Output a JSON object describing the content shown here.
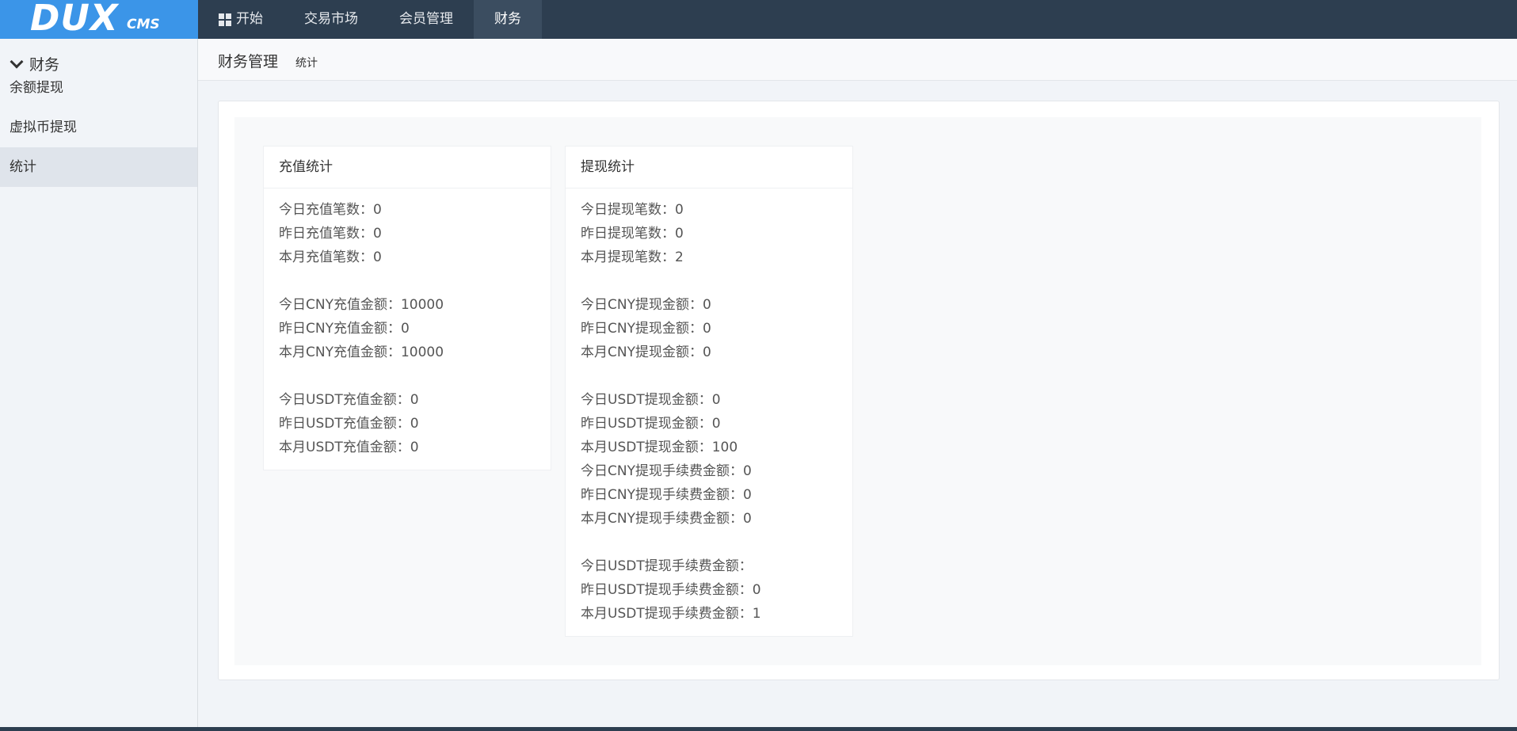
{
  "logo": {
    "main": "DUX",
    "sub": "CMS"
  },
  "nav": {
    "items": [
      {
        "label": "开始",
        "icon": "windows-icon"
      },
      {
        "label": "交易市场"
      },
      {
        "label": "会员管理"
      },
      {
        "label": "财务",
        "active": true
      }
    ]
  },
  "sidebar": {
    "heading": "财务",
    "items": [
      {
        "label": "余额提现"
      },
      {
        "label": "虚拟币提现"
      },
      {
        "label": "统计",
        "active": true
      }
    ]
  },
  "page": {
    "title": "财务管理",
    "breadcrumb": "统计"
  },
  "recharge": {
    "title": "充值统计",
    "lines": [
      "今日充值笔数：0",
      "昨日充值笔数：0",
      "本月充值笔数：0",
      "今日CNY充值金额：10000",
      "昨日CNY充值金额：0",
      "本月CNY充值金额：10000",
      "今日USDT充值金额：0",
      "昨日USDT充值金额：0",
      "本月USDT充值金额：0"
    ]
  },
  "withdraw": {
    "title": "提现统计",
    "lines": [
      "今日提现笔数：0",
      "昨日提现笔数：0",
      "本月提现笔数：2",
      "今日CNY提现金额：0",
      "昨日CNY提现金额：0",
      "本月CNY提现金额：0",
      "今日USDT提现金额：0",
      "昨日USDT提现金额：0",
      "本月USDT提现金额：100",
      "今日CNY提现手续费金额：0",
      "昨日CNY提现手续费金额：0",
      "本月CNY提现手续费金额：0",
      "今日USDT提现手续费金额：",
      "昨日USDT提现手续费金额：0",
      "本月USDT提现手续费金额：1"
    ]
  },
  "colors": {
    "topbar": "#2d3e50",
    "logo_bg": "#3b95e8",
    "active_nav": "#3b4d60",
    "sidebar_active": "#dfe4eb"
  }
}
